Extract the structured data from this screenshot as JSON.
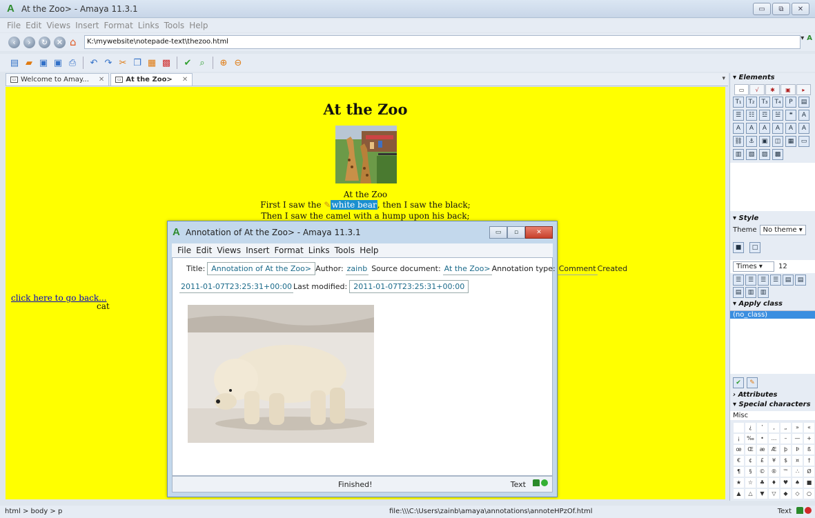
{
  "window": {
    "title": "At the Zoo> - Amaya 11.3.1"
  },
  "menu": [
    "File",
    "Edit",
    "Views",
    "Insert",
    "Format",
    "Links",
    "Tools",
    "Help"
  ],
  "address": {
    "url": "K:\\mywebsite\\notepade-text\\thezoo.html"
  },
  "tabs": [
    {
      "label": "Welcome to Amay..."
    },
    {
      "label": "At the Zoo>"
    }
  ],
  "document": {
    "heading": "At the Zoo",
    "caption": "At the Zoo",
    "line1_before": "First I saw the ",
    "line1_highlight": "white bear",
    "line1_after": ", then I saw the black;",
    "line2": "Then I saw the camel with a hump upon his back;",
    "back_link": "click here to go back...",
    "side_text": "cat"
  },
  "annotation": {
    "window_title": "Annotation of At the Zoo> - Amaya 11.3.1",
    "menu": [
      "File",
      "Edit",
      "Views",
      "Insert",
      "Format",
      "Links",
      "Tools",
      "Help"
    ],
    "title_label": "Title:",
    "title_value": "Annotation of At the Zoo>",
    "author_label": "Author:",
    "author_value": "zainb",
    "source_label": "Source document:",
    "source_value": "At the Zoo>",
    "type_label": "Annotation type:",
    "type_value": "Comment",
    "created_label": "Created",
    "created_value": "2011-01-07T23:25:31+00:00",
    "modified_label": "Last modified:",
    "modified_value": "2011-01-07T23:25:31+00:00",
    "status": "Finished!",
    "mode": "Text"
  },
  "panel": {
    "elements_title": "Elements",
    "style_title": "Style",
    "theme_label": "Theme",
    "theme_value": "No theme",
    "font_family": "Times",
    "font_size": "12",
    "apply_class_title": "Apply class",
    "class_item": "(no_class)",
    "attributes_title": "Attributes",
    "special_chars_title": "Special characters",
    "special_chars_set": "Misc",
    "special_chars": [
      "",
      "¿",
      "‛",
      "‚",
      "„",
      "»",
      "«",
      "¡",
      "‰",
      "•",
      "…",
      "–",
      "—",
      "+",
      "œ",
      "Œ",
      "æ",
      "Æ",
      "þ",
      "Þ",
      "ß",
      "€",
      "¢",
      "£",
      "¥",
      "$",
      "¤",
      "†",
      "¶",
      "§",
      "©",
      "®",
      "™",
      "∴",
      "Ø",
      "★",
      "☆",
      "♣",
      "♦",
      "♥",
      "♠",
      "■",
      "▲",
      "△",
      "▼",
      "▽",
      "◆",
      "◇",
      "○"
    ]
  },
  "statusbar": {
    "path": "html > body > p",
    "file": "file:\\\\\\C:\\Users\\zainb\\amaya\\annotations\\annoteHPzOf.html",
    "mode": "Text"
  }
}
